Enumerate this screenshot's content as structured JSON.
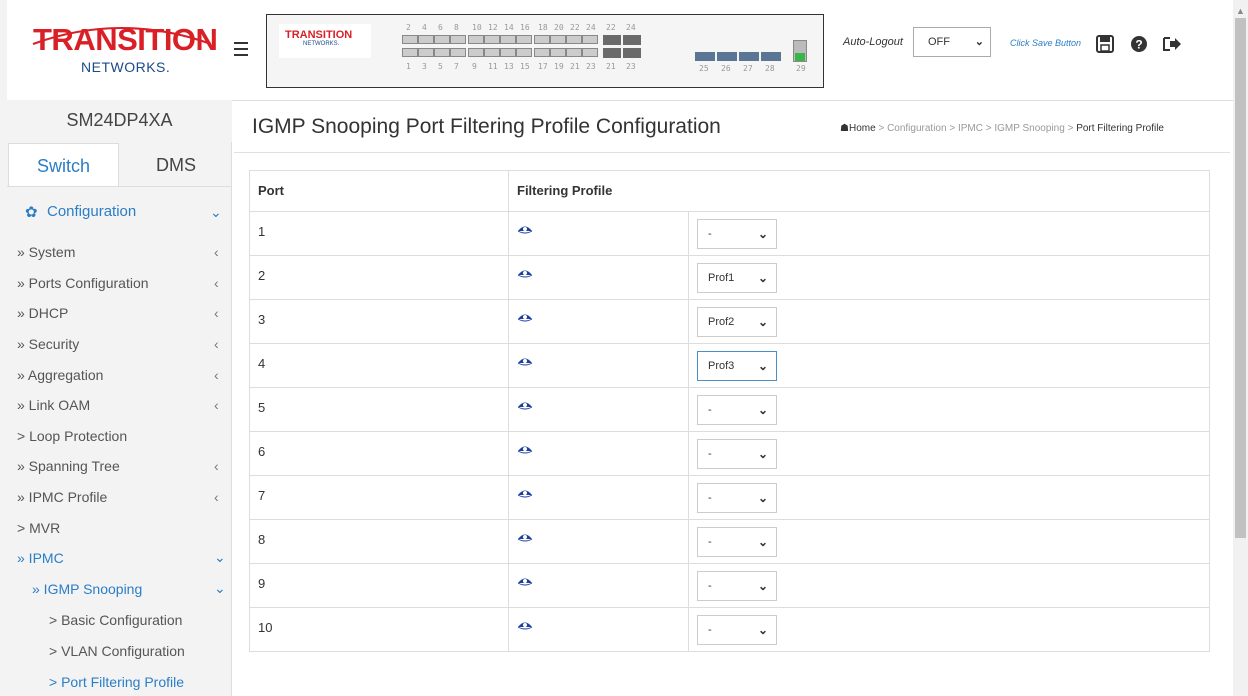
{
  "brand": {
    "logo_main": "TRANSITION",
    "logo_sub": "NETWORKS.",
    "model": "SM24DP4XA"
  },
  "tabs": [
    {
      "label": "Switch"
    },
    {
      "label": "DMS"
    }
  ],
  "sidebar": {
    "items": [
      {
        "label": "Configuration",
        "active": true
      },
      {
        "label": "» System"
      },
      {
        "label": "» Ports Configuration"
      },
      {
        "label": "» DHCP"
      },
      {
        "label": "» Security"
      },
      {
        "label": "» Aggregation"
      },
      {
        "label": "» Link OAM"
      },
      {
        "label": "> Loop Protection"
      },
      {
        "label": "» Spanning Tree"
      },
      {
        "label": "» IPMC Profile"
      },
      {
        "label": "> MVR"
      },
      {
        "label": "» IPMC",
        "active": true
      },
      {
        "label": "» IGMP Snooping",
        "active": true
      },
      {
        "label": "> Basic Configuration"
      },
      {
        "label": "> VLAN Configuration"
      },
      {
        "label": "> Port Filtering Profile",
        "active": true
      }
    ]
  },
  "header": {
    "panel_logo_main": "TRANSITION",
    "panel_logo_sub": "NETWORKS.",
    "port_numbers_top": [
      "2",
      "4",
      "6",
      "8",
      "10",
      "12",
      "14",
      "16",
      "18",
      "20",
      "22",
      "24",
      "22",
      "24"
    ],
    "port_numbers_bottom": [
      "1",
      "3",
      "5",
      "7",
      "9",
      "11",
      "13",
      "15",
      "17",
      "19",
      "21",
      "23",
      "21",
      "23",
      "25",
      "26",
      "27",
      "28",
      "29"
    ],
    "auto_logout_label": "Auto-Logout",
    "auto_logout_value": "OFF",
    "click_save": "Click Save Button",
    "icons": [
      "save-icon",
      "help-icon",
      "logout-icon"
    ]
  },
  "page": {
    "title": "IGMP Snooping Port Filtering Profile Configuration",
    "breadcrumb": [
      "Home",
      "Configuration",
      "IPMC",
      "IGMP Snooping",
      "Port Filtering Profile"
    ]
  },
  "table": {
    "headers": [
      "Port",
      "Filtering Profile"
    ],
    "rows": [
      {
        "port": "1",
        "profile": "-"
      },
      {
        "port": "2",
        "profile": "Prof1"
      },
      {
        "port": "3",
        "profile": "Prof2"
      },
      {
        "port": "4",
        "profile": "Prof3"
      },
      {
        "port": "5",
        "profile": "-"
      },
      {
        "port": "6",
        "profile": "-"
      },
      {
        "port": "7",
        "profile": "-"
      },
      {
        "port": "8",
        "profile": "-"
      },
      {
        "port": "9",
        "profile": "-"
      },
      {
        "port": "10",
        "profile": "-"
      }
    ]
  },
  "colors": {
    "accent": "#2a7ec6",
    "logo_red": "#d92027",
    "logo_blue": "#1b4a8c",
    "eye": "#1f3fa0"
  }
}
